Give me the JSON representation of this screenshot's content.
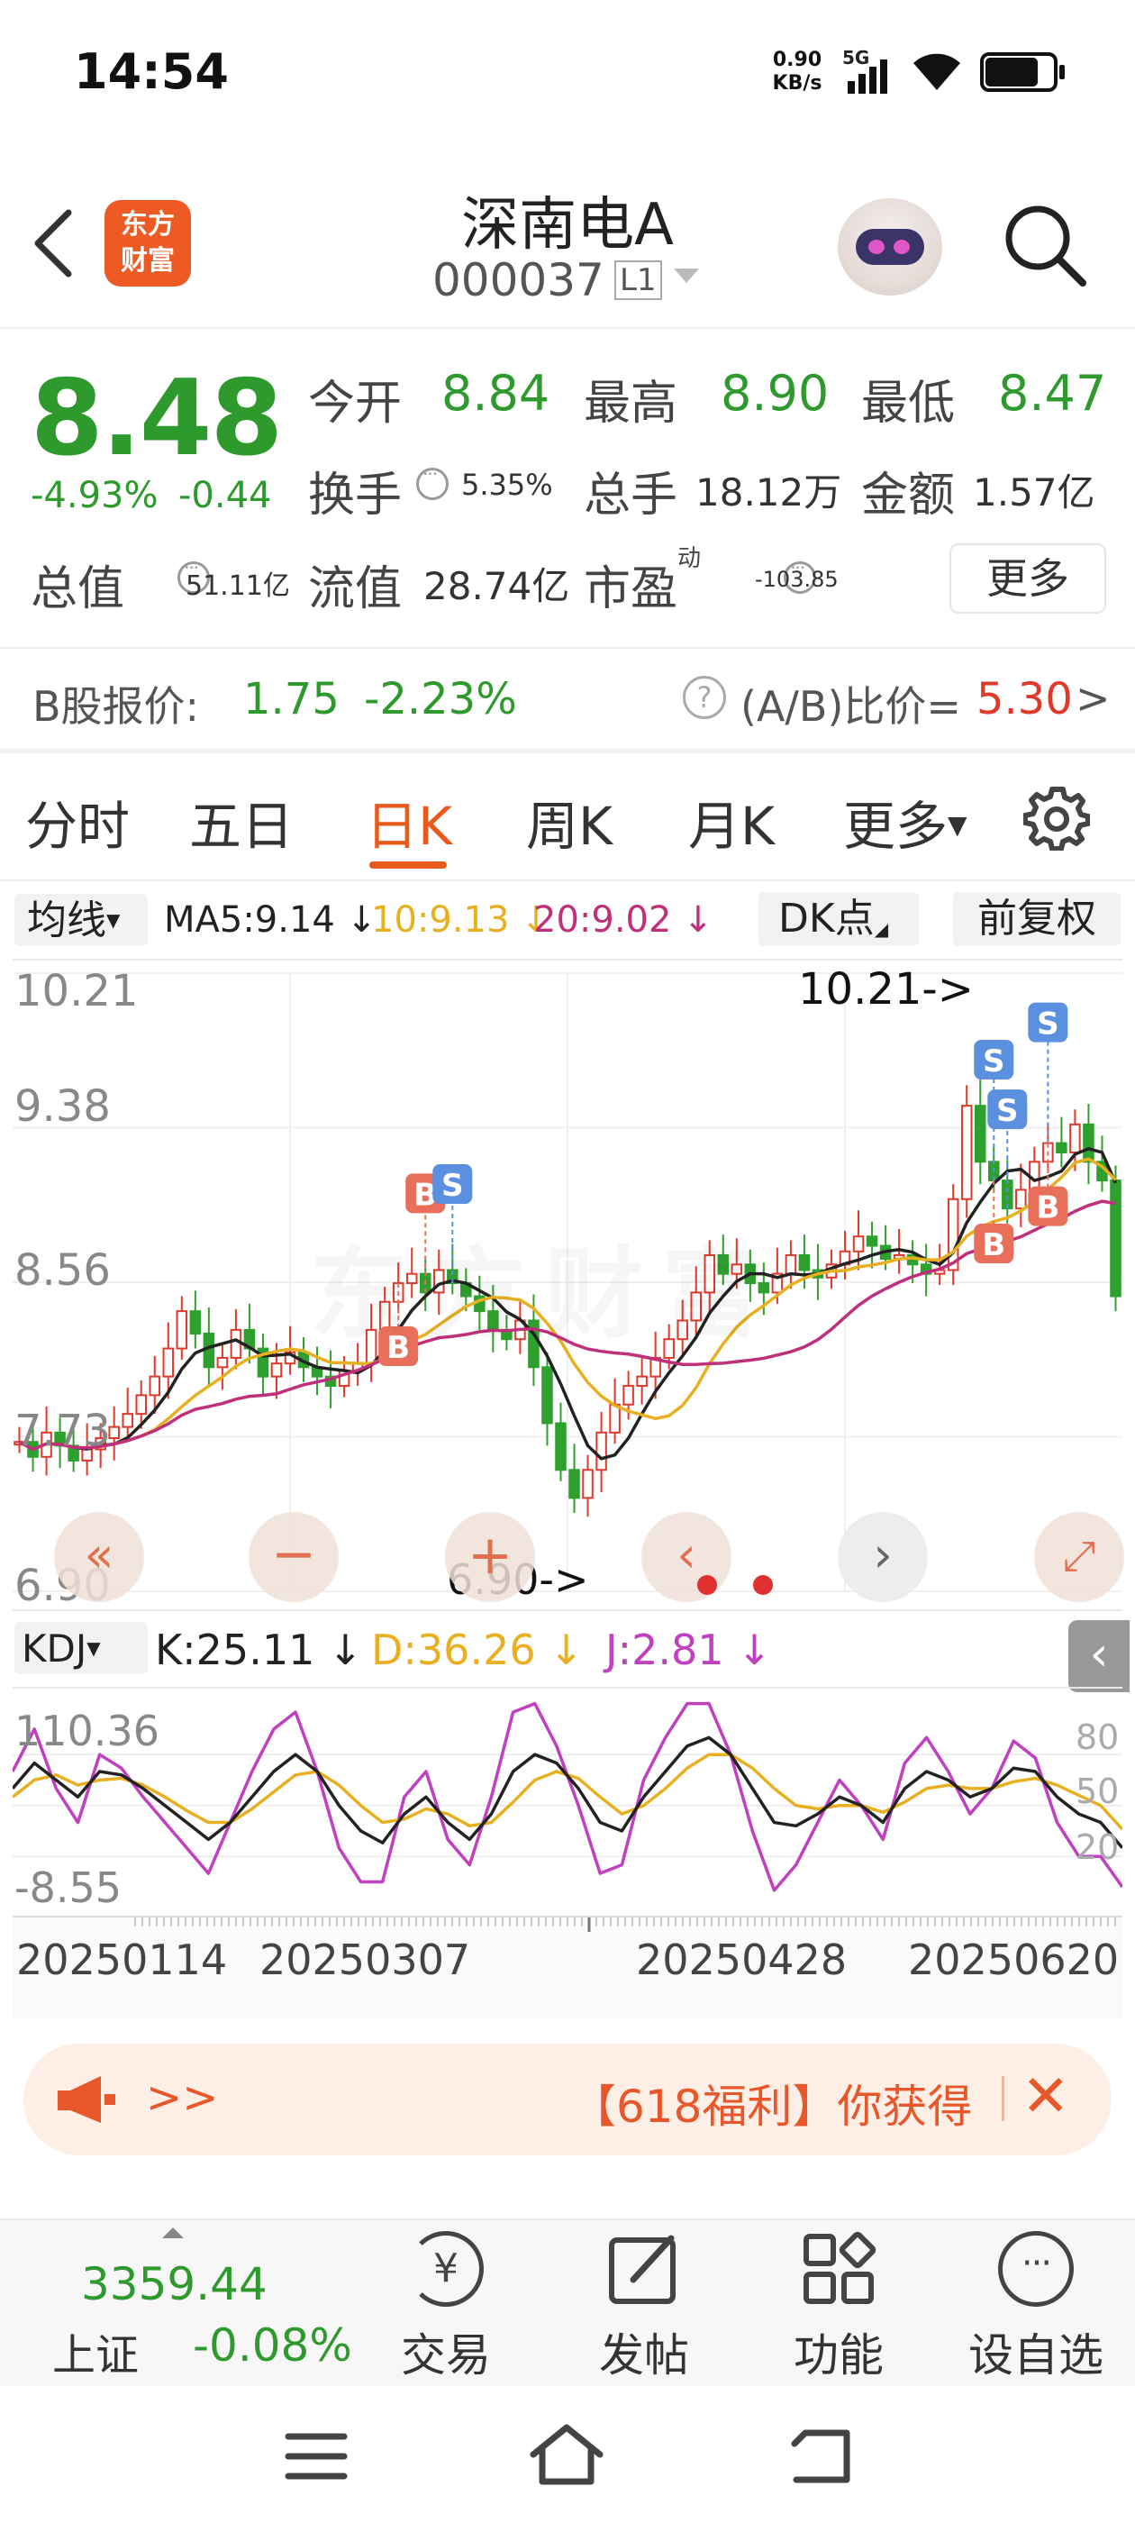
{
  "status_bar": {
    "time": "14:54",
    "net_speed_value": "0.90",
    "net_speed_unit": "KB/s",
    "network": "5G"
  },
  "header": {
    "logo_line1": "东方",
    "logo_line2": "财富",
    "title": "深南电A",
    "code": "000037",
    "level": "L1"
  },
  "quote": {
    "price": "8.48",
    "change_pct": "-4.93%",
    "change": "-0.44",
    "open_label": "今开",
    "open": "8.84",
    "high_label": "最高",
    "high": "8.90",
    "low_label": "最低",
    "low": "8.47",
    "turnover_label": "换手",
    "turnover": "5.35%",
    "volume_label": "总手",
    "volume": "18.12万",
    "amount_label": "金额",
    "amount": "1.57亿",
    "mktcap_label": "总值",
    "mktcap": "51.11亿",
    "float_label": "流值",
    "float": "28.74亿",
    "pe_label": "市盈",
    "pe_sup": "动",
    "pe": "-103.85",
    "more_button": "更多"
  },
  "bshare": {
    "label": "B股报价:",
    "price": "1.75",
    "change": "-2.23%",
    "ratio_label": "(A/B)比价=",
    "ratio": "5.30",
    "arrow": ">"
  },
  "tabs": [
    "分时",
    "五日",
    "日K",
    "周K",
    "月K",
    "更多"
  ],
  "active_tab": 2,
  "ma_bar": {
    "select": "均线",
    "ma5": "MA5:9.14 ↓",
    "ma10": "10:9.13 ↓",
    "ma20": "20:9.02 ↓",
    "dk_button": "DK点",
    "adjust_button": "前复权",
    "ma5_color": "#222222",
    "ma10_color": "#e8b020",
    "ma20_color": "#c0307a"
  },
  "kline": {
    "axis_labels": [
      "10.21",
      "9.38",
      "8.56",
      "7.73",
      "6.90"
    ],
    "high_marker": "10.21->",
    "low_marker": "6.90->",
    "watermark": "东方财富"
  },
  "kdj": {
    "select": "KDJ",
    "k": "K:25.11 ↓",
    "d": "D:36.26 ↓",
    "j": "J:2.81 ↓",
    "top_value": "110.36",
    "bottom_value": "-8.55",
    "right_labels": [
      "80",
      "50",
      "20"
    ],
    "k_color": "#222222",
    "d_color": "#e8b020",
    "j_color": "#c040c0"
  },
  "dates": [
    "20250114",
    "20250307",
    "20250428",
    "20250620"
  ],
  "banner": {
    "arrows": ">>",
    "text": "【618福利】你获得"
  },
  "bottom_nav": {
    "index_value": "3359.44",
    "index_name": "上证",
    "index_change": "-0.08%",
    "trade": "交易",
    "post": "发帖",
    "function": "功能",
    "watchlist": "设自选"
  },
  "chart_data": {
    "type": "candlestick",
    "title": "",
    "ylim": [
      6.9,
      10.21
    ],
    "ma_series": [
      {
        "name": "MA5",
        "value": 9.14,
        "color": "#222222"
      },
      {
        "name": "MA10",
        "value": 9.13,
        "color": "#e8b020"
      },
      {
        "name": "MA20",
        "value": 9.02,
        "color": "#c0307a"
      }
    ],
    "price_series": [
      7.7,
      7.62,
      7.75,
      7.68,
      7.6,
      7.66,
      7.72,
      7.78,
      7.85,
      7.95,
      8.05,
      8.2,
      8.4,
      8.28,
      8.1,
      8.15,
      8.3,
      8.2,
      8.05,
      8.12,
      8.18,
      8.1,
      8.05,
      8.0,
      8.08,
      8.12,
      8.3,
      8.45,
      8.55,
      8.6,
      8.5,
      8.62,
      8.55,
      8.48,
      8.4,
      8.3,
      8.25,
      8.35,
      8.1,
      7.8,
      7.55,
      7.4,
      7.55,
      7.75,
      7.9,
      8.0,
      8.05,
      8.15,
      8.25,
      8.35,
      8.5,
      8.7,
      8.6,
      8.65,
      8.55,
      8.5,
      8.6,
      8.7,
      8.62,
      8.58,
      8.65,
      8.72,
      8.8,
      8.75,
      8.68,
      8.7,
      8.65,
      8.6,
      8.62,
      9.0,
      9.5,
      9.2,
      9.1,
      8.95,
      9.05,
      9.2,
      9.3,
      9.25,
      9.4,
      9.2,
      9.1,
      8.48
    ],
    "kdj_k": [
      60,
      75,
      65,
      55,
      70,
      68,
      60,
      50,
      40,
      30,
      40,
      55,
      70,
      80,
      70,
      50,
      35,
      28,
      45,
      55,
      40,
      30,
      45,
      70,
      80,
      75,
      60,
      40,
      35,
      55,
      70,
      85,
      90,
      80,
      60,
      40,
      38,
      45,
      55,
      50,
      40,
      60,
      70,
      65,
      55,
      60,
      72,
      70,
      55,
      45,
      40,
      25
    ],
    "kdj_d": [
      55,
      65,
      68,
      62,
      65,
      66,
      62,
      55,
      47,
      40,
      40,
      48,
      58,
      68,
      70,
      62,
      50,
      40,
      42,
      48,
      45,
      38,
      40,
      52,
      65,
      70,
      66,
      55,
      45,
      50,
      60,
      72,
      80,
      80,
      72,
      60,
      50,
      48,
      50,
      50,
      46,
      52,
      60,
      62,
      60,
      60,
      64,
      66,
      62,
      56,
      50,
      36
    ],
    "kdj_j": [
      70,
      95,
      60,
      40,
      80,
      72,
      55,
      40,
      25,
      10,
      40,
      70,
      95,
      105,
      70,
      25,
      5,
      5,
      55,
      70,
      30,
      15,
      55,
      105,
      110,
      85,
      50,
      10,
      15,
      65,
      90,
      110,
      110,
      80,
      35,
      0,
      15,
      40,
      65,
      50,
      30,
      75,
      90,
      70,
      45,
      60,
      88,
      78,
      40,
      20,
      20,
      2
    ]
  }
}
